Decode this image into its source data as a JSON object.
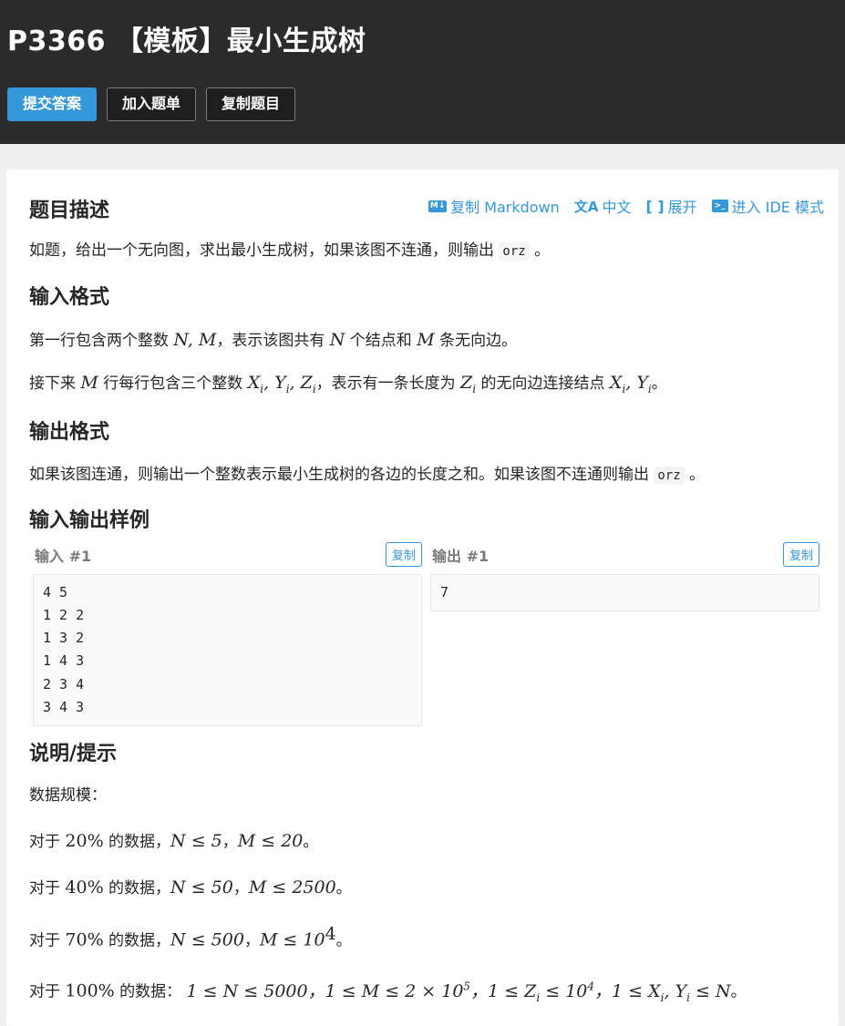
{
  "header": {
    "title": "P3366 【模板】最小生成树",
    "buttons": {
      "submit": "提交答案",
      "add_list": "加入题单",
      "copy": "复制题目"
    }
  },
  "tools": {
    "copy_md": "复制 Markdown",
    "lang": "中文",
    "expand": "展开",
    "ide": "进入 IDE 模式"
  },
  "sections": {
    "desc_title": "题目描述",
    "desc_text": "如题，给出一个无向图，求出最小生成树，如果该图不连通，则输出",
    "desc_code": "orz",
    "desc_end": "。",
    "input_title": "输入格式",
    "input_l1_a": "第一行包含两个整数",
    "input_l1_math1": "N, M",
    "input_l1_b": "，表示该图共有",
    "input_l1_math2": "N",
    "input_l1_c": "个结点和",
    "input_l1_math3": "M",
    "input_l1_d": "条无向边。",
    "input_l2_a": "接下来",
    "input_l2_math1": "M",
    "input_l2_b": "行每行包含三个整数",
    "input_l2_c": "，表示有一条长度为",
    "input_l2_d": "的无向边连接结点",
    "input_l2_e": "。",
    "output_title": "输出格式",
    "output_text": "如果该图连通，则输出一个整数表示最小生成树的各边的长度之和。如果该图不连通则输出",
    "output_code": "orz",
    "output_end": "。",
    "samples_title": "输入输出样例",
    "hint_title": "说明/提示",
    "hint_intro": "数据规模："
  },
  "samples": {
    "input_label": "输入 #1",
    "output_label": "输出 #1",
    "copy_label": "复制",
    "input": "4 5\n1 2 2\n1 3 2\n1 4 3\n2 3 4\n3 4 3",
    "output": "7"
  },
  "hints": {
    "h1_a": "对于",
    "h1_pct": "20%",
    "h1_b": "的数据，",
    "h1_m1": "N ≤ 5",
    "h1_sep": "，",
    "h1_m2": "M ≤ 20",
    "h1_end": "。",
    "h2_a": "对于",
    "h2_pct": "40%",
    "h2_b": "的数据，",
    "h2_m1": "N ≤ 50",
    "h2_sep": "，",
    "h2_m2": "M ≤ 2500",
    "h2_end": "。",
    "h3_a": "对于",
    "h3_pct": "70%",
    "h3_b": "的数据，",
    "h3_m1": "N ≤ 500",
    "h3_sep": "，",
    "h3_m2": "M ≤ 10",
    "h3_exp": "4",
    "h3_end": "。",
    "h4_a": "对于",
    "h4_pct": "100%",
    "h4_b": "的数据：",
    "h4_end": "。"
  }
}
